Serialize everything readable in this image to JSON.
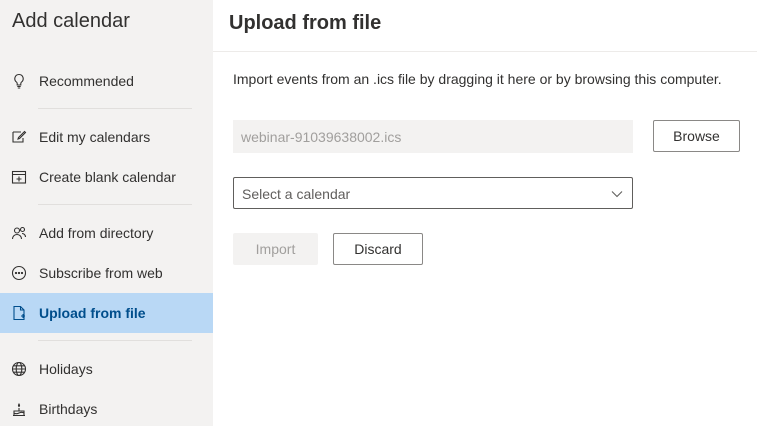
{
  "sidebar": {
    "title": "Add calendar",
    "items": [
      {
        "label": "Recommended",
        "icon": "lightbulb-icon"
      },
      {
        "label": "Edit my calendars",
        "icon": "edit-icon"
      },
      {
        "label": "Create blank calendar",
        "icon": "calendar-add-icon"
      },
      {
        "label": "Add from directory",
        "icon": "people-icon"
      },
      {
        "label": "Subscribe from web",
        "icon": "link-icon"
      },
      {
        "label": "Upload from file",
        "icon": "file-upload-icon",
        "selected": true
      },
      {
        "label": "Holidays",
        "icon": "globe-icon"
      },
      {
        "label": "Birthdays",
        "icon": "cake-icon"
      }
    ]
  },
  "main": {
    "title": "Upload from file",
    "description": "Import events from an .ics file by dragging it here or by browsing this computer.",
    "file_name": "webinar-91039638002.ics",
    "browse_label": "Browse",
    "calendar_select": {
      "selected": "Select a calendar"
    },
    "import_label": "Import",
    "discard_label": "Discard"
  },
  "colors": {
    "sidebar_bg": "#f3f2f1",
    "selected_bg": "#b9d8f5",
    "selected_text": "#004e8c",
    "disabled_bg": "#f3f2f1",
    "disabled_text": "#a19f9d"
  }
}
